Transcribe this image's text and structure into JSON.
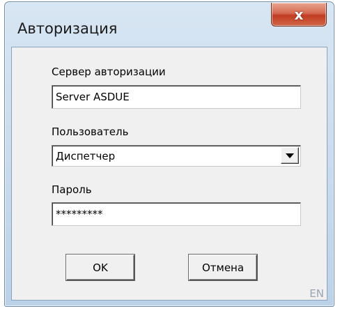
{
  "window": {
    "title": "Авторизация",
    "close_glyph": "x"
  },
  "form": {
    "server_label": "Сервер авторизации",
    "server_value": "Server ASDUE",
    "user_label": "Пользователь",
    "user_value": "Диспетчер",
    "password_label": "Пароль",
    "password_value": "*********"
  },
  "buttons": {
    "ok_label": "OK",
    "cancel_label": "Отмена"
  },
  "status": {
    "language": "EN"
  },
  "colors": {
    "close_button": "#c9452a",
    "frame": "#bcd2e8",
    "client_background": "#f0f0f0"
  },
  "icons": {
    "close": "close-icon",
    "dropdown": "chevron-down-icon"
  }
}
